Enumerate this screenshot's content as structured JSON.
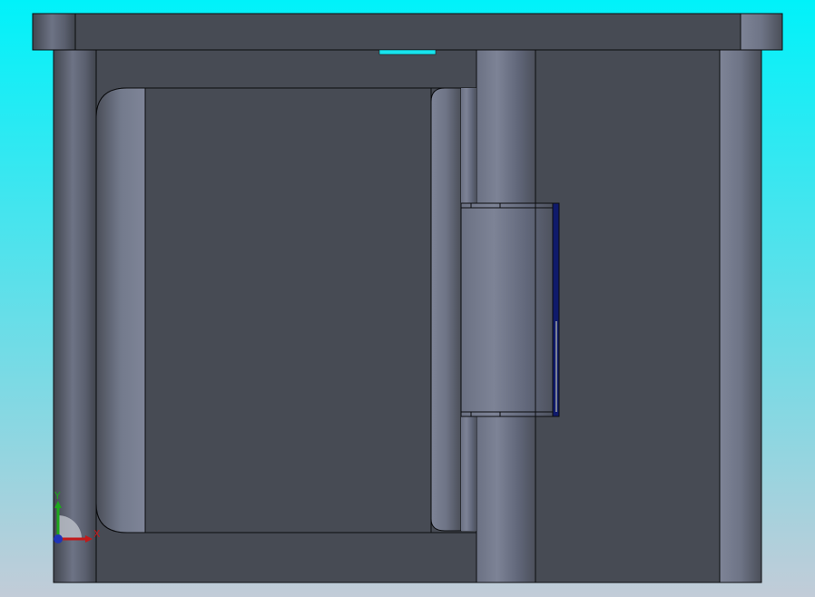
{
  "viewport": {
    "background_top": "#00F2FA",
    "background_bottom": "#C2CCD8"
  },
  "model": {
    "body_color": "#474B54",
    "edge_color": "#0B0C0E",
    "highlight_color": "#7B8193",
    "accent_blue": "#0F1A6B",
    "cyan_slot": "#17E4EE"
  },
  "triad": {
    "y_label": "Y",
    "x_label": "X",
    "y_color": "#1DA81D",
    "x_color": "#C21A1A",
    "origin_color": "#1F35B8"
  }
}
